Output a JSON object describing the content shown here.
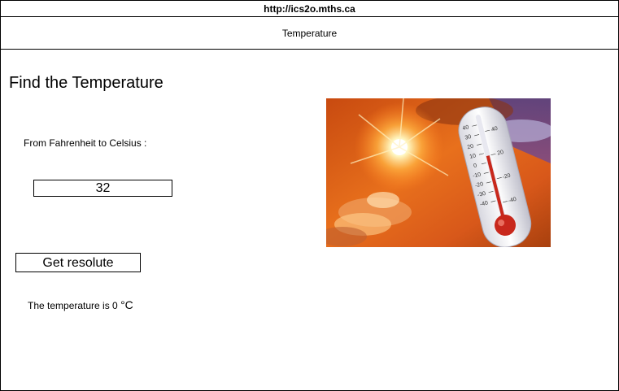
{
  "browser": {
    "url": "http://ics2o.mths.ca"
  },
  "app": {
    "title": "Temperature"
  },
  "main": {
    "heading": "Find the Temperature",
    "subtitle": "From Fahrenheit to Celsius :",
    "input_value": "32",
    "button_label": "Get resolute",
    "result_prefix": "The temperature is 0 ",
    "result_unit": "°C"
  },
  "image": {
    "icon": "thermometer-sun-photo",
    "scale_left": [
      "40",
      "30",
      "20",
      "10",
      "0",
      "-10",
      "-20",
      "-30",
      "-40"
    ],
    "scale_right": [
      "40",
      "20",
      "-20",
      "-40"
    ]
  },
  "colors": {
    "border": "#000000",
    "background": "#ffffff",
    "sky": "#e0641c",
    "mercury": "#c8281c"
  }
}
